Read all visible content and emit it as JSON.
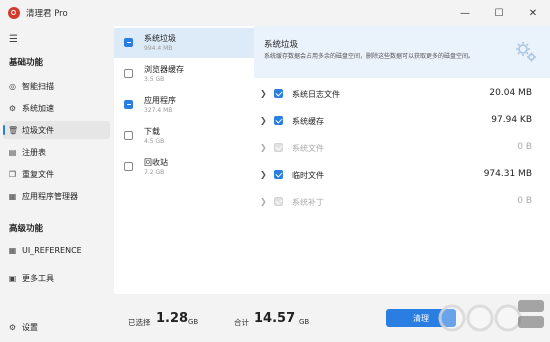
{
  "app": {
    "title": "清理君 Pro"
  },
  "window": {
    "minimize": "—",
    "maximize": "☐",
    "close": "✕"
  },
  "sidebar": {
    "menu_icon": "hamburger-icon",
    "basic_section": "基础功能",
    "basic_items": [
      {
        "label": "智能扫描",
        "icon": "scan-icon"
      },
      {
        "label": "系统加速",
        "icon": "speed-icon"
      },
      {
        "label": "垃圾文件",
        "icon": "trash-icon",
        "active": true
      },
      {
        "label": "注册表",
        "icon": "registry-icon"
      },
      {
        "label": "重复文件",
        "icon": "duplicate-icon"
      },
      {
        "label": "应用程序管理器",
        "icon": "apps-icon"
      }
    ],
    "advanced_section": "高级功能",
    "advanced_items": [
      {
        "label": "UI_REFERENCE",
        "icon": "grid-icon"
      },
      {
        "label": "更多工具",
        "icon": "tools-icon"
      }
    ],
    "settings_label": "设置"
  },
  "categories": [
    {
      "name": "系统垃圾",
      "size": "994.4 MB",
      "state": "partial",
      "selected": true
    },
    {
      "name": "浏览器缓存",
      "size": "3.5 GB",
      "state": "unchecked"
    },
    {
      "name": "应用程序",
      "size": "327.4 MB",
      "state": "partial"
    },
    {
      "name": "下载",
      "size": "4.5 GB",
      "state": "unchecked"
    },
    {
      "name": "回收站",
      "size": "7.2 GB",
      "state": "unchecked"
    }
  ],
  "detail": {
    "title": "系统垃圾",
    "description": "系统缓存数据会占用多余的磁盘空间，删除这些数据可以获取更多的磁盘空间。",
    "rows": [
      {
        "name": "系统日志文件",
        "size": "20.04 MB",
        "state": "checked"
      },
      {
        "name": "系统缓存",
        "size": "97.94 KB",
        "state": "checked"
      },
      {
        "name": "系统文件",
        "size": "0 B",
        "state": "disabled"
      },
      {
        "name": "临时文件",
        "size": "974.31 MB",
        "state": "checked"
      },
      {
        "name": "系统补丁",
        "size": "0 B",
        "state": "disabled"
      }
    ]
  },
  "footer": {
    "selected_label": "已选择",
    "selected_value": "1.28",
    "selected_unit": "GB",
    "total_label": "合计",
    "total_value": "14.57",
    "total_unit": "GB",
    "clean_button": "清理"
  },
  "colors": {
    "accent": "#2a7de1",
    "selected_bg": "#ddeaf8",
    "header_bg": "#eaf2fb"
  }
}
